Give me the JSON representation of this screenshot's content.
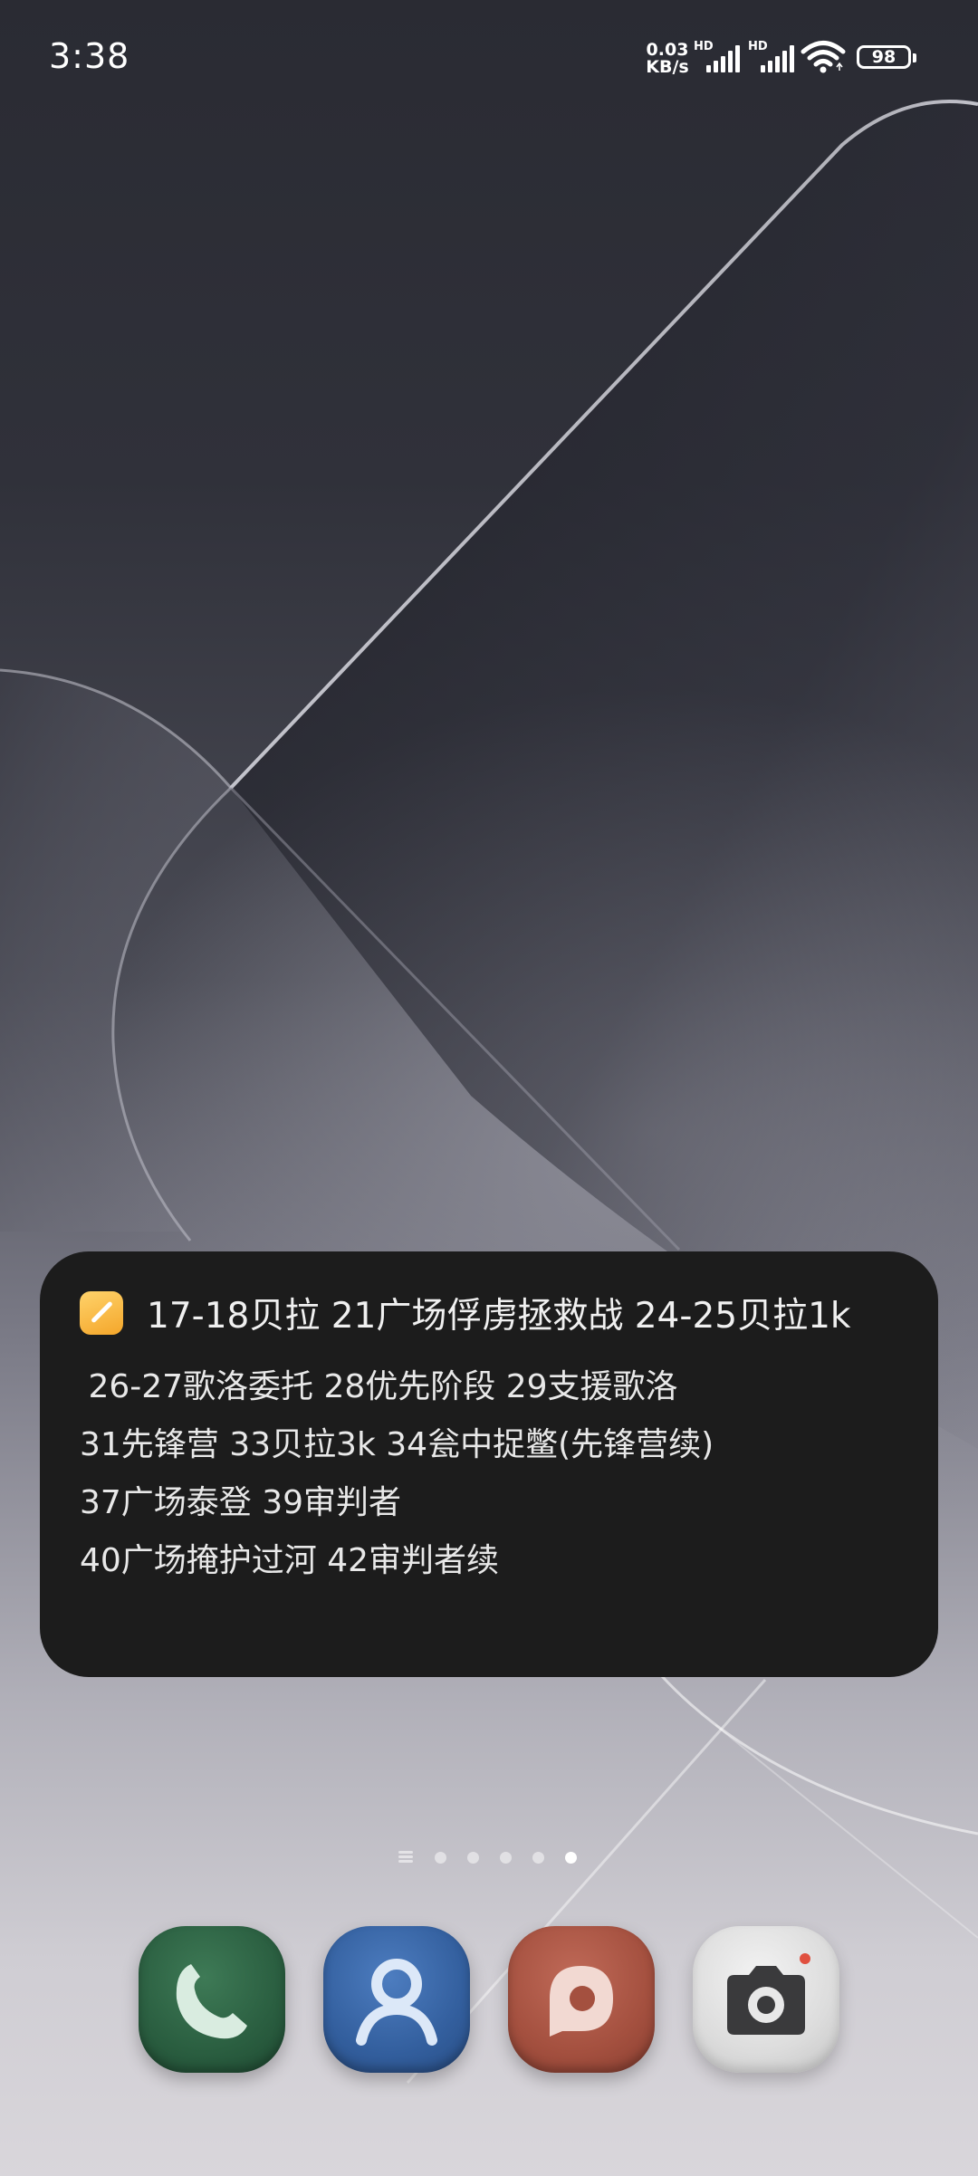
{
  "status_bar": {
    "time": "3:38",
    "net_speed_value": "0.03",
    "net_speed_unit": "KB/s",
    "sim1_label": "HD",
    "sim2_label": "HD",
    "battery_level": "98",
    "icons": [
      "signal-icon",
      "signal-icon",
      "wifi-icon",
      "battery-icon"
    ]
  },
  "note_widget": {
    "icon": "notes-app-icon",
    "lines": [
      "17-18贝拉 21广场俘虏拯救战 24-25贝拉1k",
      " 26-27歌洛委托 28优先阶段 29支援歌洛",
      "31先锋营 33贝拉3k 34瓮中捉鳖(先锋营续)",
      "37广场泰登 39审判者",
      "40广场掩护过河 42审判者续"
    ]
  },
  "page_indicator": {
    "pages": 5,
    "active_page": 5
  },
  "dock": {
    "apps": [
      {
        "name": "phone",
        "icon": "phone-icon",
        "color": "#2e6446"
      },
      {
        "name": "contacts",
        "icon": "contacts-icon",
        "color": "#3563a3"
      },
      {
        "name": "messages",
        "icon": "messages-icon",
        "color": "#a4503f"
      },
      {
        "name": "camera",
        "icon": "camera-icon",
        "color": "#dcdcdc"
      }
    ]
  }
}
